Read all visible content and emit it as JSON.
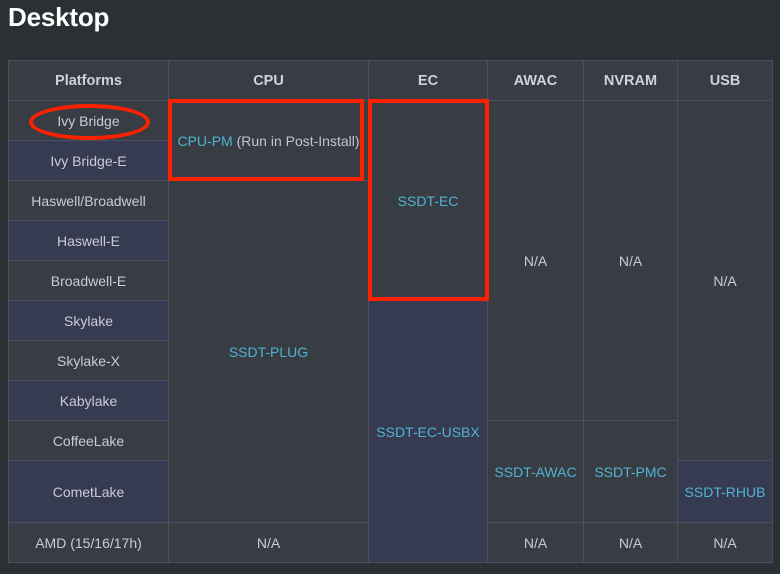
{
  "page": {
    "title": "Desktop",
    "background_color": "#2b3034",
    "link_color": "#4fb3d4",
    "text_color": "#c8cdd4",
    "annotation_color": "#ff2000",
    "row_color_dark": "#383d43",
    "row_color_alt": "#363b51",
    "border_color": "#4a4f63"
  },
  "table": {
    "headers": [
      "Platforms",
      "CPU",
      "EC",
      "AWAC",
      "NVRAM",
      "USB"
    ],
    "platforms": [
      "Ivy Bridge",
      "Ivy Bridge-E",
      "Haswell/Broadwell",
      "Haswell-E",
      "Broadwell-E",
      "Skylake",
      "Skylake-X",
      "Kabylake",
      "CoffeeLake",
      "CometLake",
      "AMD (15/16/17h)"
    ],
    "cells": {
      "cpu_ivy_bridge_link": "CPU-PM",
      "cpu_ivy_bridge_note": " (Run in Post-Install)",
      "cpu_plug": "SSDT-PLUG",
      "cpu_amd": "N/A",
      "ec_ssdt_ec": "SSDT-EC",
      "ec_ssdt_ec_usbx": "SSDT-EC-USBX",
      "awac_na": "N/A",
      "awac_ssdt": "SSDT-AWAC",
      "awac_amd_na": "N/A",
      "nvram_na": "N/A",
      "nvram_ssdt": "SSDT-PMC",
      "nvram_amd_na": "N/A",
      "usb_na": "N/A",
      "usb_ssdt": "SSDT-RHUB",
      "usb_amd_na": "N/A"
    }
  },
  "annotations": {
    "ivy_bridge_ellipse": "Ivy Bridge",
    "cpu_box": "CPU-PM (Run in Post-Install)",
    "ec_box": "SSDT-EC"
  }
}
